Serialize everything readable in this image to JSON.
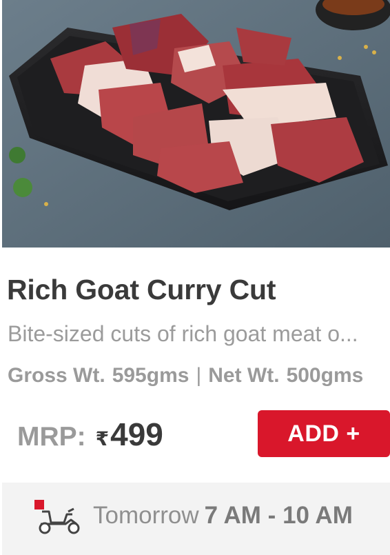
{
  "product": {
    "image_alt": "goat meat curry cut on a black tray",
    "title": "Rich Goat Curry Cut",
    "description": "Bite-sized cuts of rich goat meat o...",
    "gross_label": "Gross Wt.",
    "gross_value": "595gms",
    "separator": "|",
    "net_label": "Net Wt.",
    "net_value": "500gms"
  },
  "price": {
    "mrp_label": "MRP:",
    "currency_symbol": "₹",
    "amount": "499"
  },
  "add_button": {
    "label": "ADD +"
  },
  "delivery": {
    "day": "Tomorrow",
    "slot": "7 AM - 10 AM",
    "icon": "scooter-delivery-icon"
  },
  "colors": {
    "accent": "#d9172b",
    "title_text": "#3a3a3a",
    "muted_text": "#9a9a9a",
    "delivery_bg": "#f3f3f3"
  }
}
